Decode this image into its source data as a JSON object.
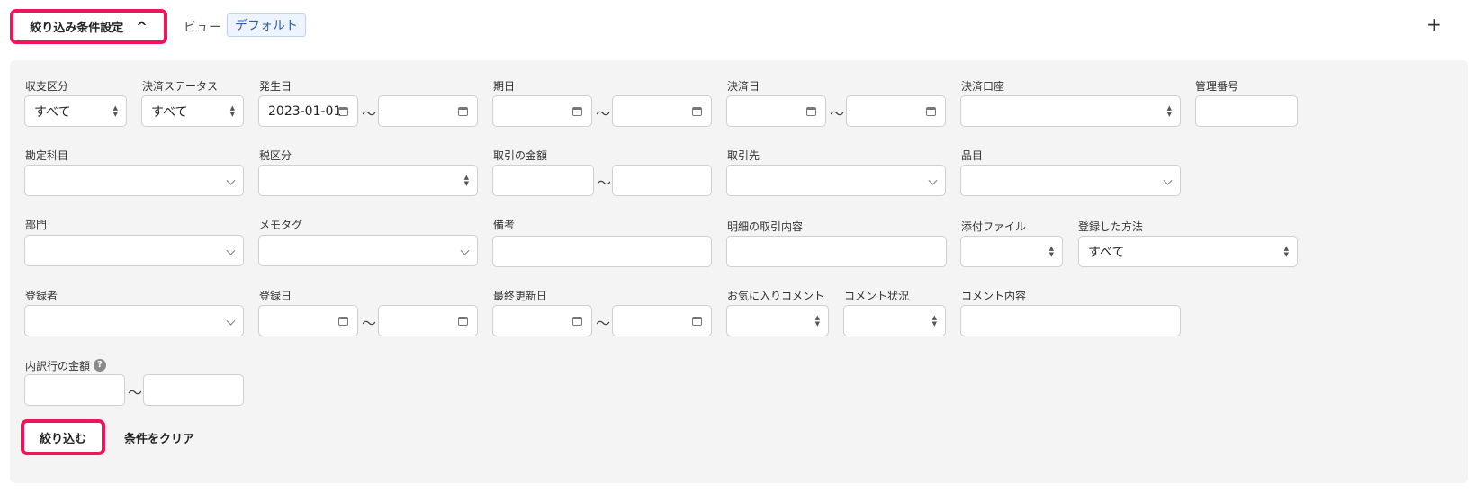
{
  "header": {
    "toggle_label": "絞り込み条件設定",
    "view_label": "ビュー",
    "view_value": "デフォルト",
    "add_label": "+"
  },
  "filters": {
    "income_type": {
      "label": "収支区分",
      "value": "すべて"
    },
    "payment_status": {
      "label": "決済ステータス",
      "value": "すべて"
    },
    "occurrence_date": {
      "label": "発生日",
      "from": "2023-01-01",
      "to": ""
    },
    "due_date": {
      "label": "期日"
    },
    "payment_date": {
      "label": "決済日"
    },
    "payment_account": {
      "label": "決済口座"
    },
    "management_no": {
      "label": "管理番号"
    },
    "account_item": {
      "label": "勘定科目"
    },
    "tax_category": {
      "label": "税区分"
    },
    "amount": {
      "label": "取引の金額"
    },
    "partner": {
      "label": "取引先"
    },
    "item": {
      "label": "品目"
    },
    "department": {
      "label": "部門"
    },
    "memo_tag": {
      "label": "メモタグ"
    },
    "remarks": {
      "label": "備考"
    },
    "detail_content": {
      "label": "明細の取引内容"
    },
    "attachment": {
      "label": "添付ファイル"
    },
    "registration_method": {
      "label": "登録した方法",
      "value": "すべて"
    },
    "registrant": {
      "label": "登録者"
    },
    "registration_date": {
      "label": "登録日"
    },
    "last_updated": {
      "label": "最終更新日"
    },
    "favorite_comment": {
      "label": "お気に入りコメント"
    },
    "comment_status": {
      "label": "コメント状況"
    },
    "comment_content": {
      "label": "コメント内容"
    },
    "breakdown_amount": {
      "label": "内訳行の金額"
    }
  },
  "range_separator": "〜",
  "actions": {
    "apply_label": "絞り込む",
    "clear_label": "条件をクリア"
  },
  "colors": {
    "highlight": "#f0145a",
    "panel_bg": "#f5f4f4",
    "chip_bg": "#eef4ff",
    "chip_text": "#2b5fb3"
  }
}
